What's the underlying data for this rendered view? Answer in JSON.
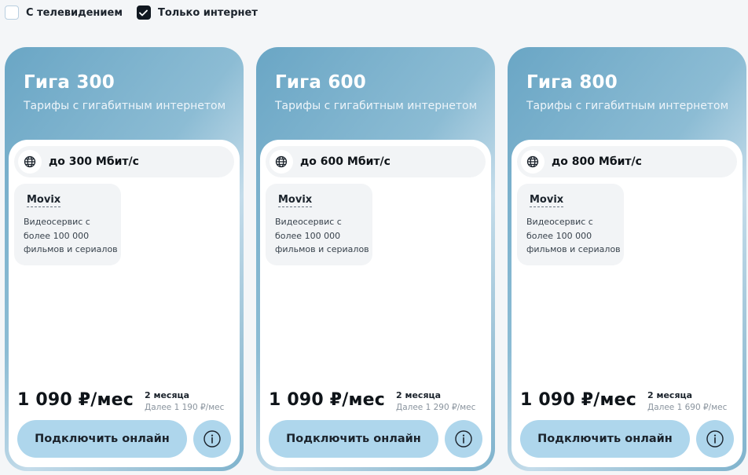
{
  "filters": [
    {
      "label": "С телевидением",
      "checked": false
    },
    {
      "label": "Только интернет",
      "checked": true
    }
  ],
  "icons": {
    "check": "check-icon",
    "globe": "globe-icon",
    "info": "info-icon"
  },
  "colors": {
    "button": "#aed6ec",
    "card_gradient_start": "#6aa6c5",
    "checkbox_checked": "#111820"
  },
  "cards": [
    {
      "title": "Гига 300",
      "subtitle": "Тарифы с гигабитным интернетом",
      "speed": "до 300 Мбит/с",
      "service": {
        "name": "Movix",
        "desc": "Видеосервис с более 100 000 фильмов и сериалов"
      },
      "price": "1 090 ₽/мес",
      "promo_period": "2 месяца",
      "after_price": "Далее 1 190 ₽/мес",
      "button": "Подключить онлайн"
    },
    {
      "title": "Гига 600",
      "subtitle": "Тарифы с гигабитным интернетом",
      "speed": "до 600 Мбит/с",
      "service": {
        "name": "Movix",
        "desc": "Видеосервис с более 100 000 фильмов и сериалов"
      },
      "price": "1 090 ₽/мес",
      "promo_period": "2 месяца",
      "after_price": "Далее 1 290 ₽/мес",
      "button": "Подключить онлайн"
    },
    {
      "title": "Гига 800",
      "subtitle": "Тарифы с гигабитным интернетом",
      "speed": "до 800 Мбит/с",
      "service": {
        "name": "Movix",
        "desc": "Видеосервис с более 100 000 фильмов и сериалов"
      },
      "price": "1 090 ₽/мес",
      "promo_period": "2 месяца",
      "after_price": "Далее 1 690 ₽/мес",
      "button": "Подключить онлайн"
    }
  ]
}
